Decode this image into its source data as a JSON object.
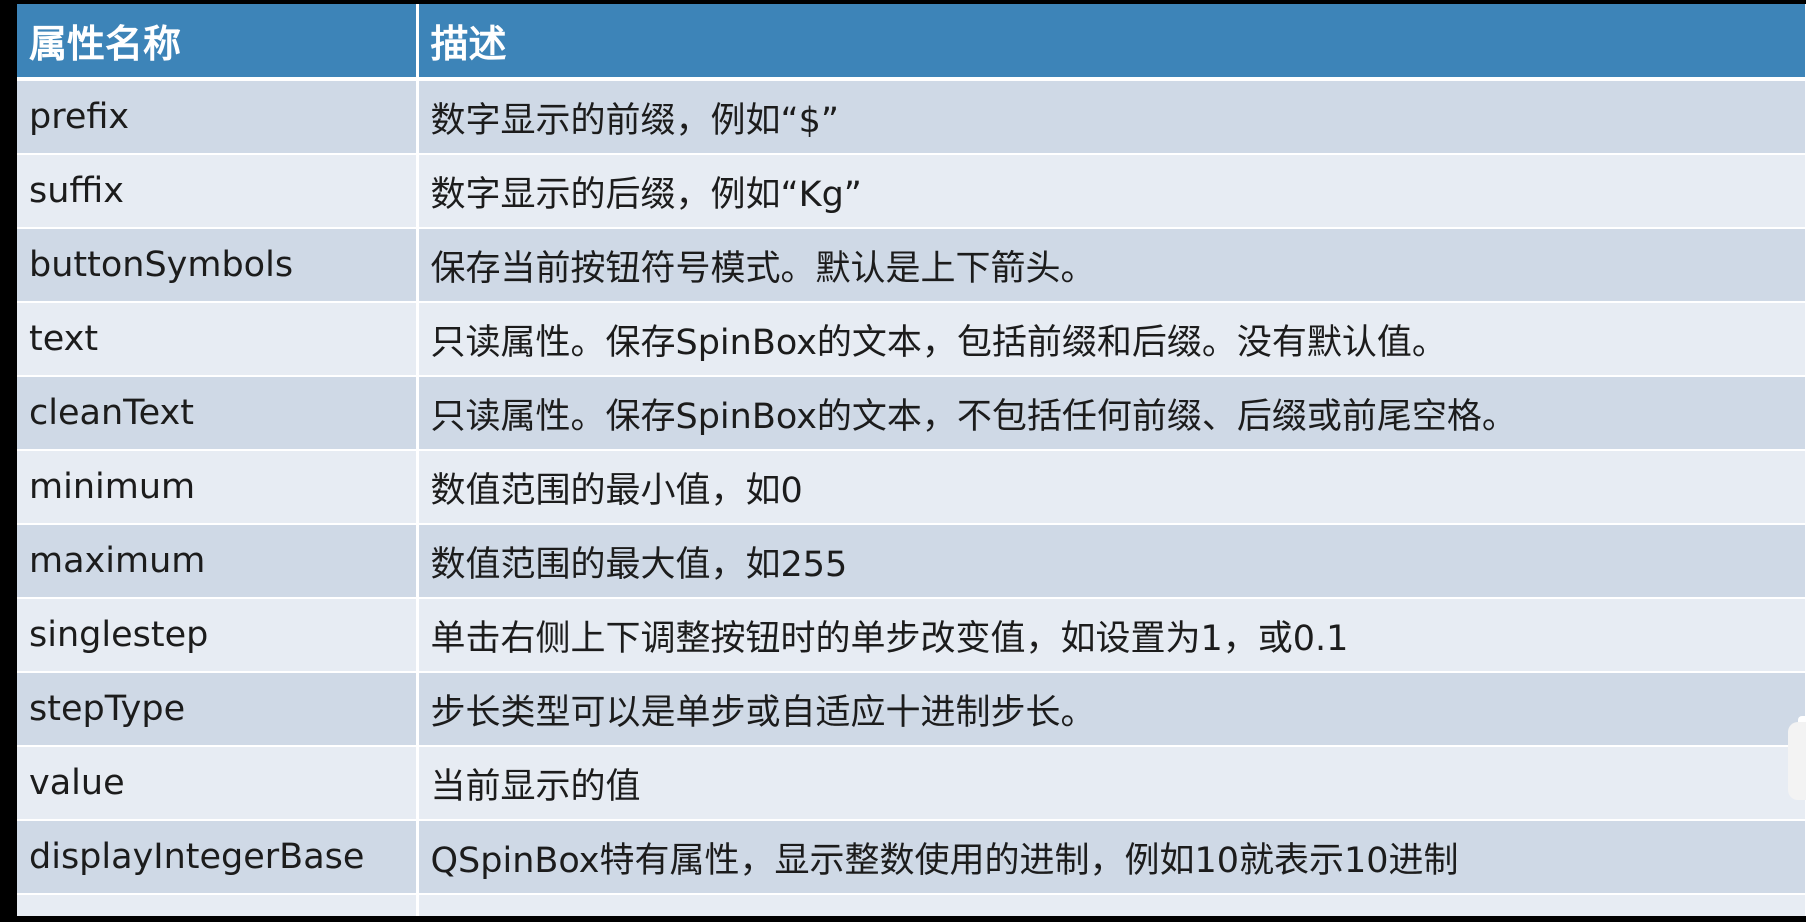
{
  "table": {
    "headers": [
      "属性名称",
      "描述"
    ],
    "rows": [
      {
        "name": "prefix",
        "desc": "数字显示的前缀，例如“$”"
      },
      {
        "name": "suffix",
        "desc": "数字显示的后缀，例如“Kg”"
      },
      {
        "name": "buttonSymbols",
        "desc": "保存当前按钮符号模式。默认是上下箭头。"
      },
      {
        "name": "text",
        "desc": "只读属性。保存SpinBox的文本，包括前缀和后缀。没有默认值。"
      },
      {
        "name": "cleanText",
        "desc": "只读属性。保存SpinBox的文本，不包括任何前缀、后缀或前尾空格。"
      },
      {
        "name": "minimum",
        "desc": "数值范围的最小值，如0"
      },
      {
        "name": "maximum",
        "desc": "数值范围的最大值，如255"
      },
      {
        "name": "singlestep",
        "desc": "单击右侧上下调整按钮时的单步改变值，如设置为1，或0.1"
      },
      {
        "name": "stepType",
        "desc": "步长类型可以是单步或自适应十进制步长。"
      },
      {
        "name": "value",
        "desc": "当前显示的值"
      },
      {
        "name": "displayIntegerBase",
        "desc": "QSpinBox特有属性，显示整数使用的进制，例如10就表示10进制"
      }
    ]
  },
  "colors": {
    "header_bg": "#3d84b8",
    "row_odd": "#cfd9e6",
    "row_even": "#e7ecf3"
  }
}
